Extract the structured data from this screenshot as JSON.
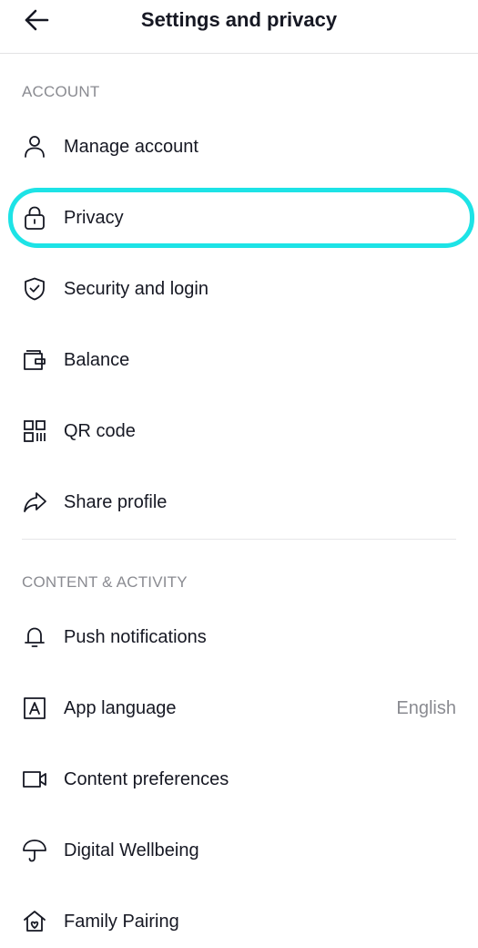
{
  "header": {
    "title": "Settings and privacy",
    "back_icon": "arrow-left-icon"
  },
  "sections": [
    {
      "title": "ACCOUNT",
      "items": [
        {
          "label": "Manage account",
          "icon": "person-icon"
        },
        {
          "label": "Privacy",
          "icon": "lock-icon"
        },
        {
          "label": "Security and login",
          "icon": "shield-check-icon"
        },
        {
          "label": "Balance",
          "icon": "wallet-icon"
        },
        {
          "label": "QR code",
          "icon": "qr-code-icon"
        },
        {
          "label": "Share profile",
          "icon": "share-arrow-icon"
        }
      ]
    },
    {
      "title": "CONTENT & ACTIVITY",
      "items": [
        {
          "label": "Push notifications",
          "icon": "bell-icon"
        },
        {
          "label": "App language",
          "icon": "language-icon",
          "value": "English"
        },
        {
          "label": "Content preferences",
          "icon": "video-camera-icon"
        },
        {
          "label": "Digital Wellbeing",
          "icon": "umbrella-icon"
        },
        {
          "label": "Family Pairing",
          "icon": "family-house-icon"
        }
      ]
    }
  ],
  "colors": {
    "highlight": "#1de3e6",
    "text": "#161823",
    "muted": "#8a8b91"
  }
}
